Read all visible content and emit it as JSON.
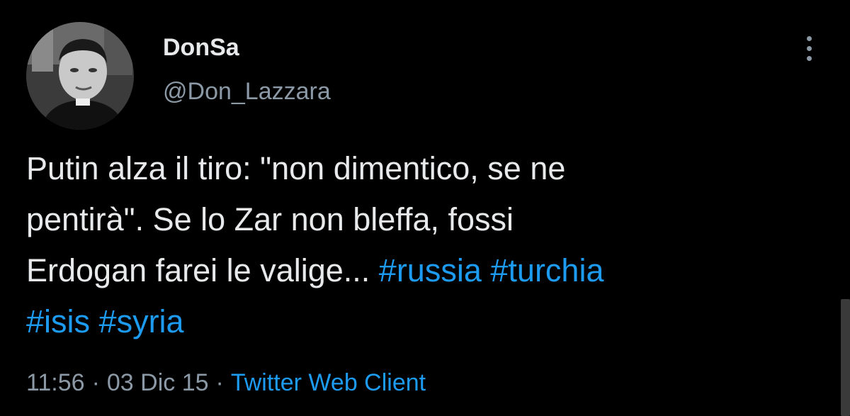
{
  "colors": {
    "background": "#000000",
    "text_primary": "#e7e9ea",
    "text_secondary": "#8b98a5",
    "link": "#1d9bf0"
  },
  "author": {
    "display_name": "DonSa",
    "handle": "@Don_Lazzara",
    "avatar_icon": "profile-photo"
  },
  "more_menu": {
    "icon": "more-vertical-icon"
  },
  "tweet": {
    "text_line1": "Putin alza il tiro: \"non dimentico, se ne",
    "text_line2": "pentirà\". Se lo Zar non bleffa, fossi",
    "text_line3_plain": "Erdogan farei le valige... ",
    "hashtags": [
      "#russia",
      "#turchia",
      "#isis",
      "#syria"
    ]
  },
  "meta": {
    "time": "11:56",
    "separator": "·",
    "date": "03 Dic 15",
    "source": "Twitter Web Client"
  }
}
